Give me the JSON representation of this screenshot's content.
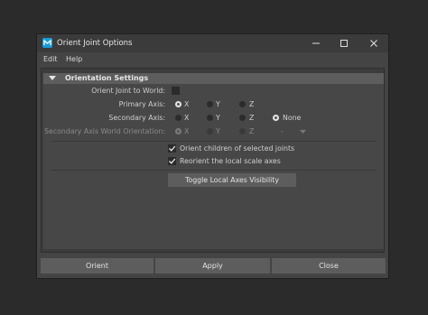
{
  "window": {
    "title": "Orient Joint Options"
  },
  "menu": [
    "Edit",
    "Help"
  ],
  "frame": {
    "title": "Orientation Settings"
  },
  "rows": {
    "orient_world": {
      "label": "Orient Joint to World:"
    },
    "primary_axis": {
      "label": "Primary Axis:",
      "options": [
        "X",
        "Y",
        "Z"
      ],
      "selected": "X"
    },
    "secondary_axis": {
      "label": "Secondary Axis:",
      "options": [
        "X",
        "Y",
        "Z",
        "None"
      ],
      "selected": "None"
    },
    "secondary_world": {
      "label": "Secondary Axis World Orientation:",
      "options": [
        "X",
        "Y",
        "Z",
        "-"
      ],
      "disabled": true
    }
  },
  "checkboxes": [
    {
      "label": "Orient children of selected joints",
      "checked": true
    },
    {
      "label": "Reorient the local scale axes",
      "checked": true
    }
  ],
  "toggle_button": "Toggle Local Axes Visibility",
  "buttons": {
    "orient": "Orient",
    "apply": "Apply",
    "close": "Close"
  }
}
